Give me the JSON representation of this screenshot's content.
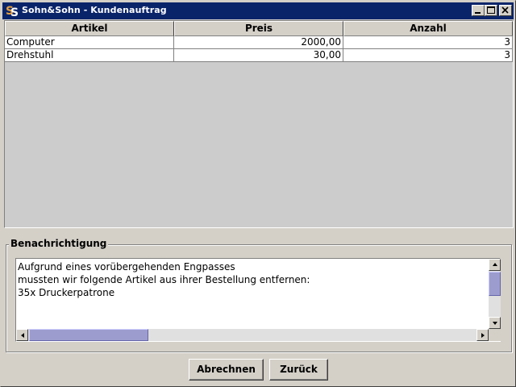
{
  "window": {
    "title": "Sohn&Sohn - Kundenauftrag"
  },
  "table": {
    "columns": [
      "Artikel",
      "Preis",
      "Anzahl"
    ],
    "rows": [
      {
        "artikel": "Computer",
        "preis": "2000,00",
        "anzahl": "3"
      },
      {
        "artikel": "Drehstuhl",
        "preis": "30,00",
        "anzahl": "3"
      }
    ]
  },
  "notification": {
    "title": "Benachrichtigung",
    "text": "Aufgrund eines vorübergehenden Engpasses\nmussten wir folgende Artikel aus ihrer Bestellung entfernen:\n35x Druckerpatrone"
  },
  "buttons": {
    "checkout": "Abrechnen",
    "back": "Zurück"
  },
  "colors": {
    "titlebar": "#0a246a",
    "panel": "#d4d0c8",
    "table_bg": "#cccccc",
    "scroll_thumb": "#9c9cce"
  }
}
